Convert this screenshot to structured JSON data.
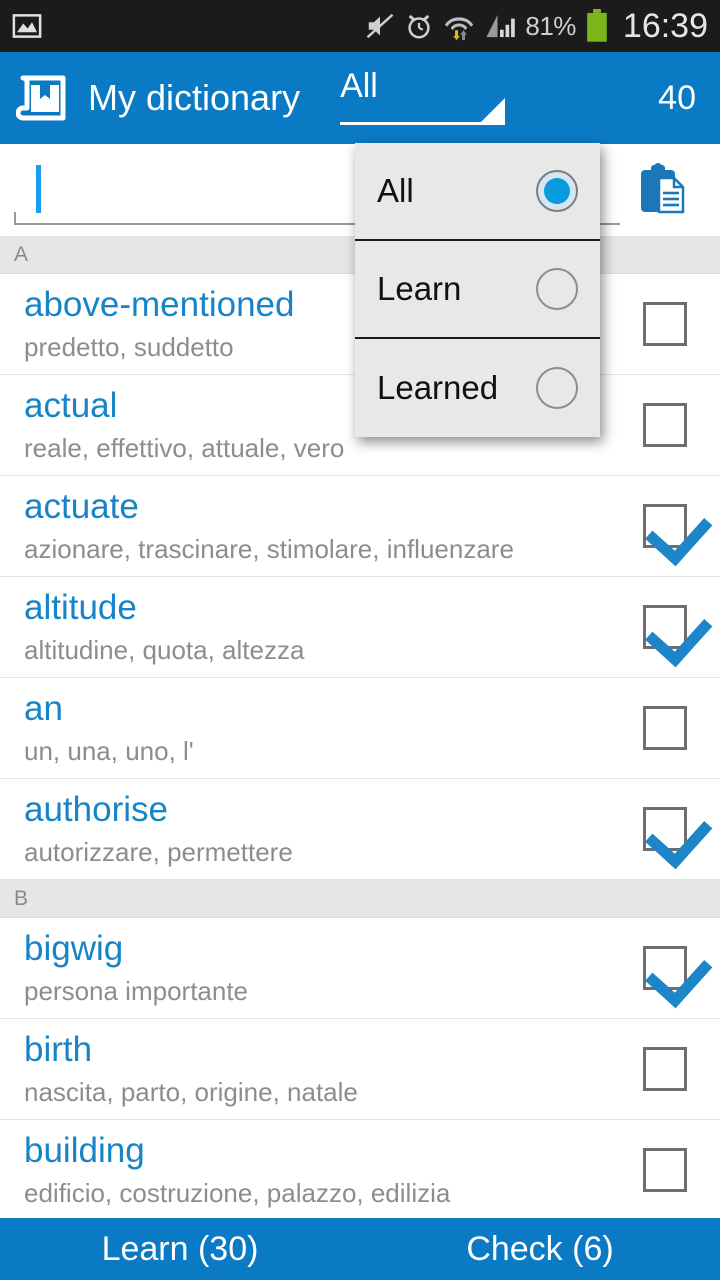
{
  "status_bar": {
    "time": "16:39",
    "battery_percent": "81%",
    "icons": [
      "image-icon",
      "mute-icon",
      "alarm-icon",
      "wifi-transfer-icon",
      "signal-icon",
      "battery-icon"
    ]
  },
  "action_bar": {
    "app_icon": "book-bookmark-icon",
    "title": "My dictionary",
    "filter_label": "All",
    "count": "40"
  },
  "search": {
    "value": "",
    "placeholder": "",
    "paste_icon": "clipboard-paste-icon"
  },
  "dropdown": {
    "visible": true,
    "items": [
      {
        "label": "All",
        "selected": true
      },
      {
        "label": "Learn",
        "selected": false
      },
      {
        "label": "Learned",
        "selected": false
      }
    ]
  },
  "list": {
    "sections": [
      {
        "letter": "A",
        "entries": [
          {
            "word": "above-mentioned",
            "translation": "predetto, suddetto",
            "checked": false
          },
          {
            "word": "actual",
            "translation": "reale, effettivo, attuale, vero",
            "checked": false
          },
          {
            "word": "actuate",
            "translation": "azionare, trascinare, stimolare, influenzare",
            "checked": true
          },
          {
            "word": "altitude",
            "translation": "altitudine, quota, altezza",
            "checked": true
          },
          {
            "word": "an",
            "translation": "un, una, uno, l'",
            "checked": false
          },
          {
            "word": "authorise",
            "translation": "autorizzare, permettere",
            "checked": true
          }
        ]
      },
      {
        "letter": "B",
        "entries": [
          {
            "word": "bigwig",
            "translation": "persona importante",
            "checked": true
          },
          {
            "word": "birth",
            "translation": "nascita, parto, origine, natale",
            "checked": false
          },
          {
            "word": "building",
            "translation": "edificio, costruzione, palazzo, edilizia",
            "checked": false
          }
        ]
      }
    ]
  },
  "bottom_bar": {
    "learn_label": "Learn (30)",
    "check_label": "Check (6)"
  },
  "colors": {
    "accent_blue": "#0b7ac4",
    "word_blue": "#1784c7",
    "status_bg": "#1b1b1b",
    "battery_green": "#7cb61a"
  }
}
